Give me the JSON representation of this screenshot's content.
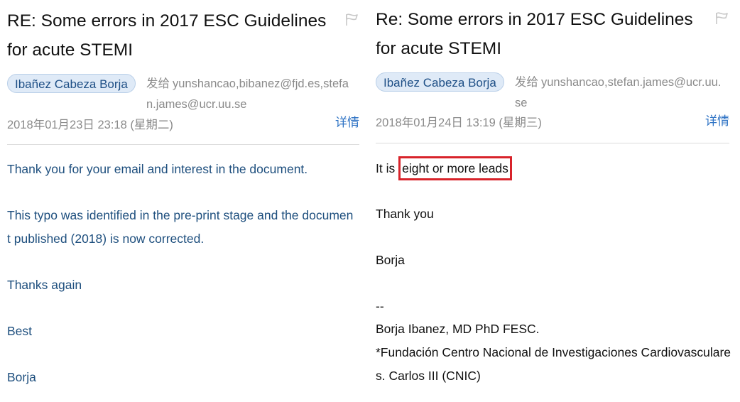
{
  "left_email": {
    "subject": "RE: Some errors in 2017 ESC Guidelines for acute STEMI",
    "sender": "Ibañez Cabeza Borja",
    "recipients_prefix": "发给",
    "recipients": "yunshancao,bibanez@fjd.es,stefan.james@ucr.uu.se",
    "date": "2018年01月23日 23:18 (星期二)",
    "details_label": "详情",
    "body": {
      "p1": "Thank you for your email and interest in the document.",
      "p2": "This typo was identified in the pre-print stage and the document published (2018) is now corrected.",
      "p3": "Thanks again",
      "p4": "Best",
      "p5": "Borja"
    }
  },
  "right_email": {
    "subject": "Re: Some errors in 2017 ESC Guidelines for acute STEMI",
    "sender": "Ibañez Cabeza Borja",
    "recipients_prefix": "发给",
    "recipients": "yunshancao,stefan.james@ucr.uu.se",
    "date": "2018年01月24日 13:19 (星期三)",
    "details_label": "详情",
    "body": {
      "line1_prefix": "It is",
      "line1_highlight": "eight or more leads",
      "thanks": "Thank you",
      "name": "Borja",
      "sig_sep": "--",
      "sig_name": "Borja Ibanez, MD PhD FESC.",
      "sig_affiliation": "*Fundación Centro Nacional de Investigaciones Cardiovasculares. Carlos III (CNIC)"
    }
  },
  "colors": {
    "chip_bg": "#dfeaf7",
    "chip_text": "#1e4f86",
    "link": "#2d72c4",
    "left_body_text": "#1e4f7e",
    "highlight_border": "#d8232a",
    "meta_text": "#8a8a8a"
  },
  "icons": {
    "flag": "flag-icon"
  }
}
